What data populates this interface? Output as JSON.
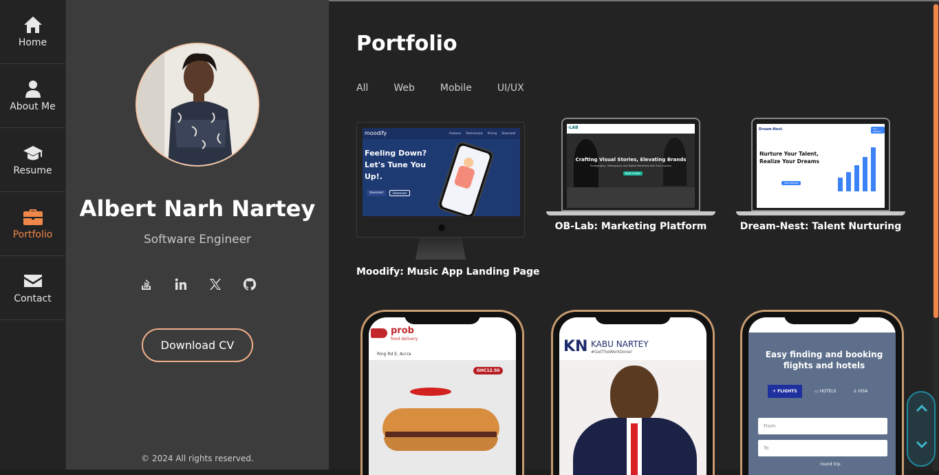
{
  "nav": {
    "items": [
      {
        "label": "Home",
        "icon": "home-icon"
      },
      {
        "label": "About Me",
        "icon": "user-icon"
      },
      {
        "label": "Resume",
        "icon": "graduation-cap-icon"
      },
      {
        "label": "Portfolio",
        "icon": "briefcase-icon",
        "active": true
      },
      {
        "label": "Contact",
        "icon": "envelope-icon"
      }
    ]
  },
  "profile": {
    "name": "Albert Narh Nartey",
    "role": "Software Engineer",
    "download_cv": "Download CV",
    "copyright": "© 2024 All rights reserved.",
    "socials": [
      "stack-overflow-icon",
      "linkedin-icon",
      "x-icon",
      "github-icon"
    ]
  },
  "main": {
    "title": "Portfolio",
    "filters": [
      "All",
      "Web",
      "Mobile",
      "UI/UX"
    ],
    "projects": [
      {
        "title": "Moodify: Music App Landing Page",
        "screen": {
          "brand": "moodify",
          "nav": [
            "Features",
            "Testimonials",
            "Pricing",
            "Download"
          ],
          "headline": "Feeling Down? Let's Tune You Up!.",
          "btn1": "Download",
          "btn2": "Download"
        }
      },
      {
        "title": "OB-Lab: Marketing Platform",
        "screen": {
          "brand": "-LAB",
          "headline": "Crafting Visual Stories, Elevating Brands",
          "sub": "Photography, Videography and Digital Marketing that Truly Inspires",
          "btn": "Book A Date"
        }
      },
      {
        "title": "Dream-Nest: Talent Nurturing",
        "screen": {
          "brand": "Dream-Nest.",
          "headline": "Nurture Your Talent, Realize Your Dreams",
          "btn": "Get Started",
          "nav_btn": "Get Started"
        }
      },
      {
        "screen": {
          "brand": "prob",
          "sub": "food delivery",
          "location": "Ring Rd E, Accra",
          "price": "GHC12.50"
        }
      },
      {
        "screen": {
          "brand": "KABU NARTEY",
          "tagline": "#GetTheWorkDone!"
        }
      },
      {
        "screen": {
          "headline": "Easy finding and booking flights and hotels",
          "tabs": [
            "FLIGHTS",
            "HOTELS",
            "VISA"
          ],
          "from": "From",
          "to": "To",
          "toggle": "round trip"
        }
      }
    ]
  },
  "colors": {
    "accent": "#f0874a",
    "scroll_ctl": "#1f8aa0"
  }
}
